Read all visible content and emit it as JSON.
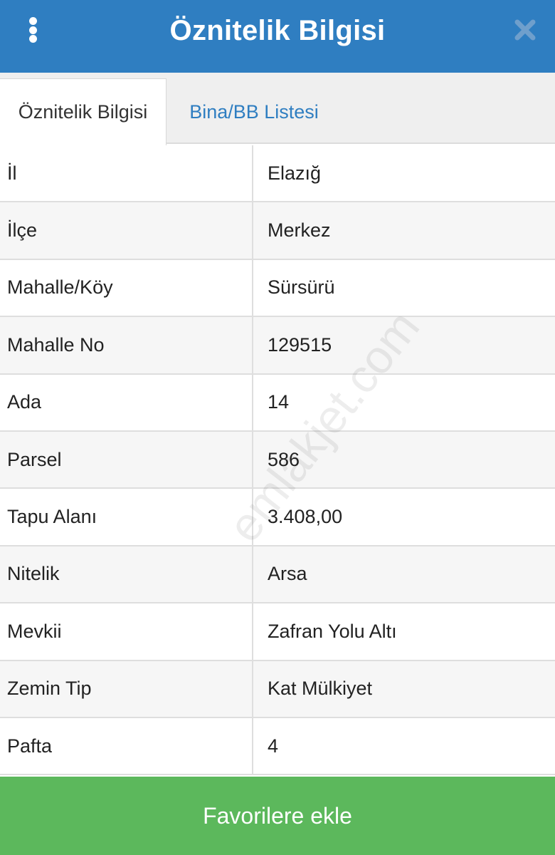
{
  "header": {
    "title": "Öznitelik Bilgisi",
    "menu_icon": "more-vertical-icon",
    "close_icon": "close-icon",
    "background_color": "#2f7ec1"
  },
  "tabs": [
    {
      "label": "Öznitelik Bilgisi",
      "active": true
    },
    {
      "label": "Bina/BB Listesi",
      "active": false
    }
  ],
  "attributes": [
    {
      "label": "İl",
      "value": "Elazığ"
    },
    {
      "label": "İlçe",
      "value": "Merkez"
    },
    {
      "label": "Mahalle/Köy",
      "value": "Sürsürü"
    },
    {
      "label": "Mahalle No",
      "value": "129515"
    },
    {
      "label": "Ada",
      "value": "14"
    },
    {
      "label": "Parsel",
      "value": "586"
    },
    {
      "label": "Tapu Alanı",
      "value": "3.408,00"
    },
    {
      "label": "Nitelik",
      "value": "Arsa"
    },
    {
      "label": "Mevkii",
      "value": "Zafran Yolu Altı"
    },
    {
      "label": "Zemin Tip",
      "value": "Kat Mülkiyet"
    },
    {
      "label": "Pafta",
      "value": "4"
    }
  ],
  "footer": {
    "button_label": "Favorilere ekle",
    "button_color": "#5cb85c"
  },
  "watermark": "emlakjet.com"
}
